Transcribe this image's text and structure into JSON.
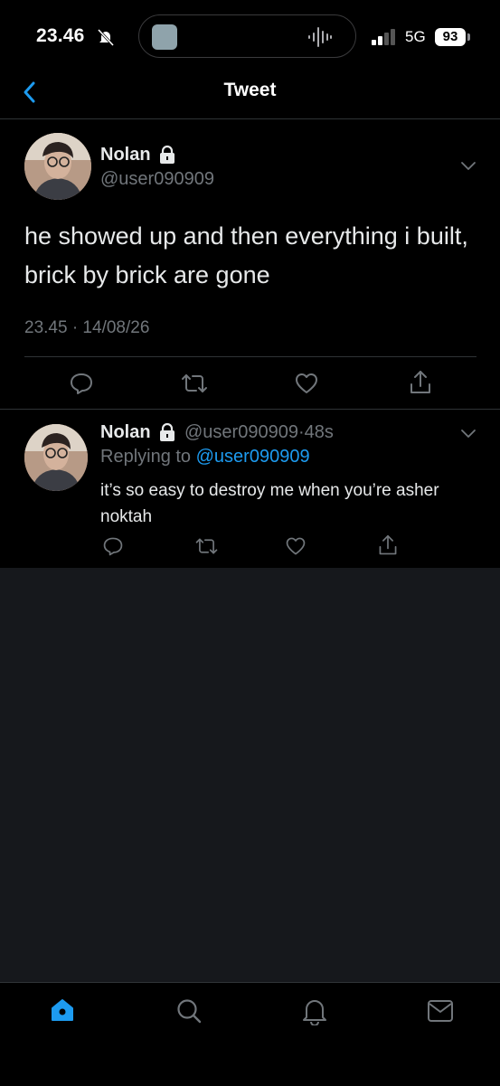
{
  "status_bar": {
    "time": "23.46",
    "network": "5G",
    "battery": "93"
  },
  "nav": {
    "title": "Tweet"
  },
  "main_tweet": {
    "name": "Nolan",
    "handle": "@user090909",
    "text": "he showed up and then everything i built, brick by brick are gone",
    "timestamp": "23.45 · 14/08/26"
  },
  "reply": {
    "name": "Nolan",
    "handle": "@user090909",
    "separator": "·",
    "time": "48s",
    "replying_prefix": "Replying to",
    "replying_handle": "@user090909",
    "text": "it’s so easy to destroy me when you’re asher noktah"
  },
  "colors": {
    "accent": "#1d9bf0",
    "background": "#000000",
    "muted_text": "#71767b",
    "empty_area": "#16181c"
  },
  "icons": {
    "back": "chevron-left-icon",
    "lock": "lock-icon",
    "more": "chevron-down-icon",
    "reply": "reply-icon",
    "retweet": "retweet-icon",
    "like": "heart-icon",
    "share": "share-icon",
    "home": "home-icon",
    "search": "search-icon",
    "notifications": "bell-icon",
    "messages": "mail-icon"
  }
}
